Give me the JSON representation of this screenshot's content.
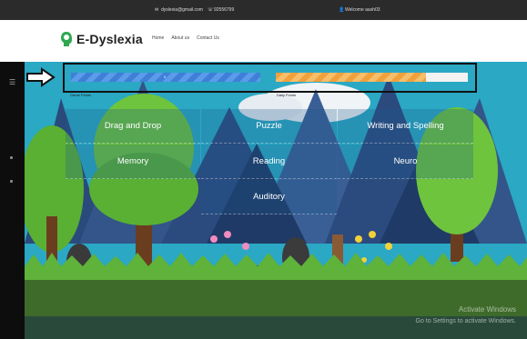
{
  "topbar": {
    "email": "dyslexia@gmail.com",
    "phone": "92556799",
    "welcome": "Welcome aash03"
  },
  "header": {
    "logo_text": "E-Dyslexia",
    "nav": [
      "Home",
      "About us",
      "Contact Us"
    ]
  },
  "progress": {
    "game_points_label": "Game Points",
    "daily_points_label": "Daily Points",
    "game_points_value": "0",
    "daily_points_value": "",
    "game_points_fill": 1.0,
    "daily_points_fill": 0.78
  },
  "menu": {
    "items": [
      "Drag and Drop",
      "Puzzle",
      "Writing and Spelling",
      "Memory",
      "Reading",
      "Neuro",
      "Auditory"
    ]
  },
  "watermark": {
    "title": "Activate Windows",
    "subtitle": "Go to Settings to activate Windows."
  },
  "colors": {
    "accent_blue": "#3f7fd8",
    "accent_orange": "#f0a13c",
    "logo_green": "#2fa84f"
  }
}
